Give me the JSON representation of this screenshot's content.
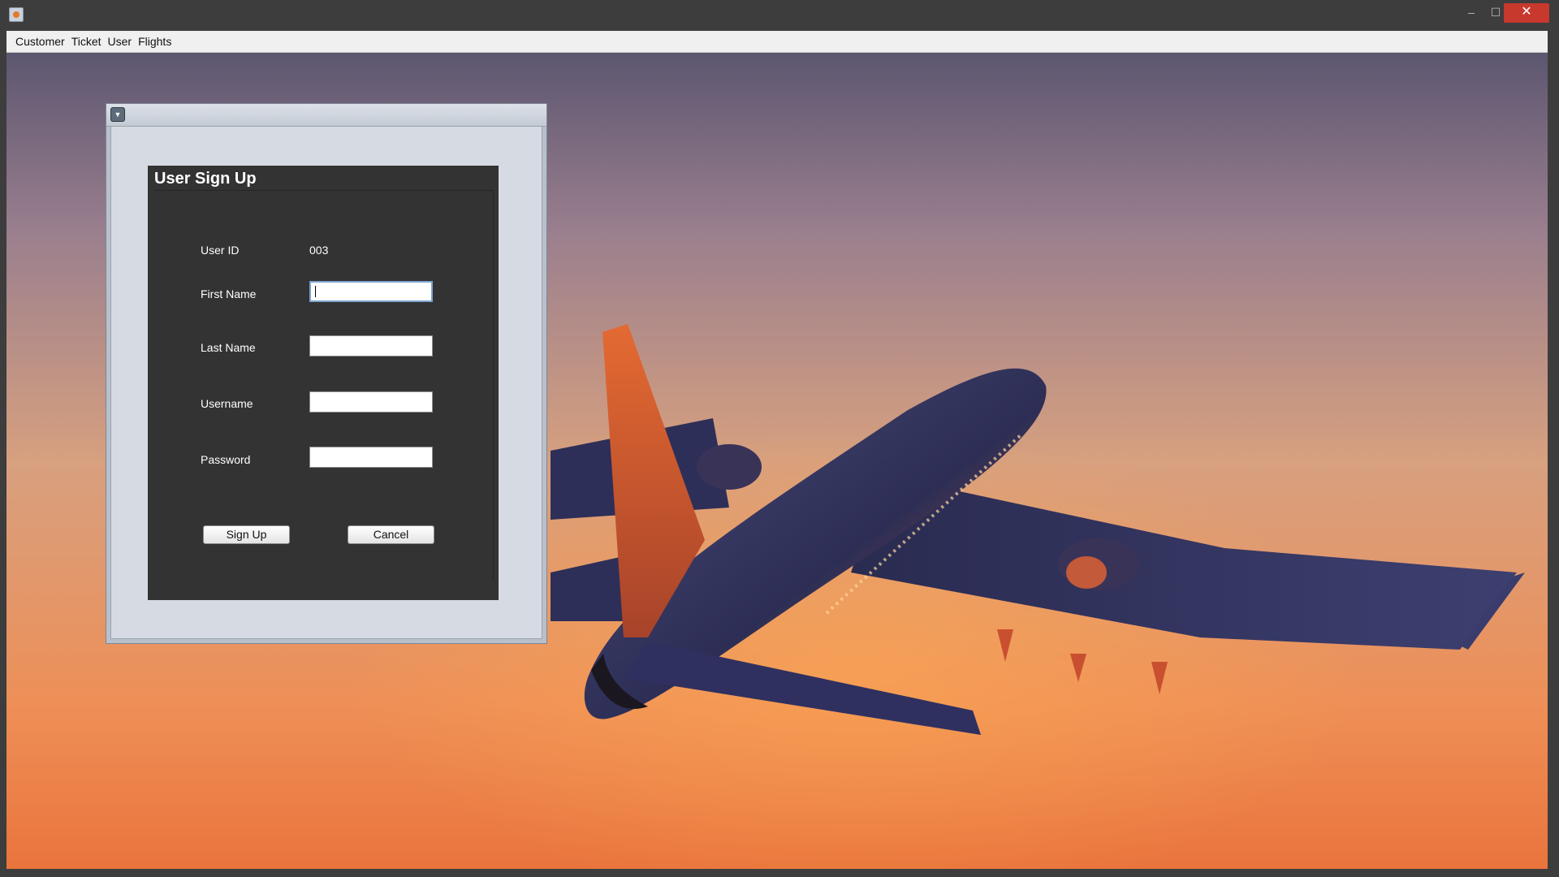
{
  "window": {
    "close_glyph": "✕",
    "minimize_glyph": "–",
    "maximize_glyph": "☐"
  },
  "menu": [
    {
      "label": "Customer"
    },
    {
      "label": "Ticket"
    },
    {
      "label": "User"
    },
    {
      "label": "Flights"
    }
  ],
  "dialog": {
    "menu_glyph": "▼",
    "title": "User Sign Up",
    "user_id_label": "User ID",
    "user_id_value": "003",
    "first_name_label": "First Name",
    "first_name_value": "",
    "last_name_label": "Last Name",
    "last_name_value": "",
    "username_label": "Username",
    "username_value": "",
    "password_label": "Password",
    "password_value": "",
    "sign_up_label": "Sign Up",
    "cancel_label": "Cancel"
  },
  "colors": {
    "panel": "#333333",
    "close": "#c7392d",
    "sky_top": "#5c5670",
    "sky_bottom": "#e9743c"
  },
  "icons": [
    "app-icon",
    "dropdown-icon",
    "close-icon",
    "minimize-icon",
    "maximize-icon"
  ]
}
